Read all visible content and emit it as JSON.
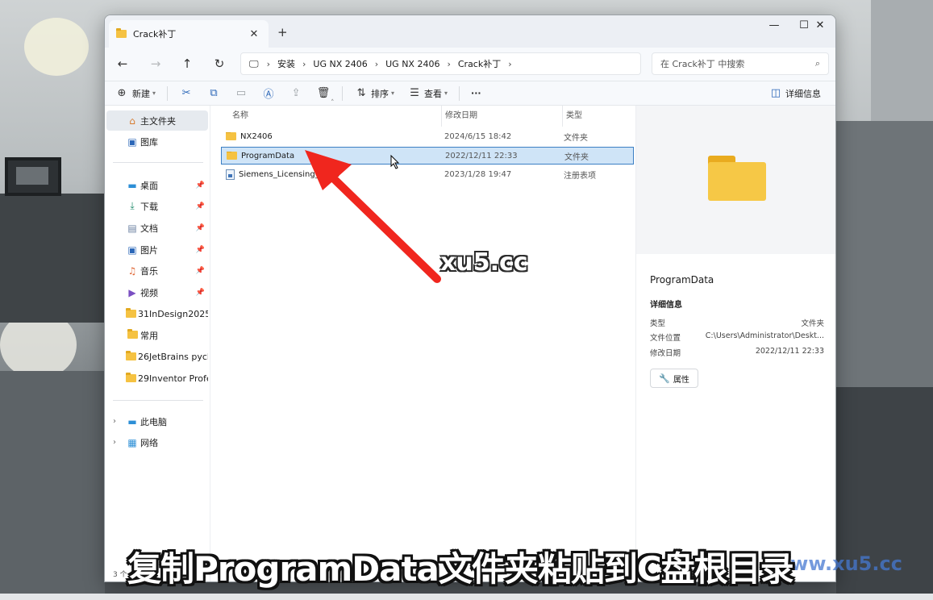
{
  "window": {
    "tab_title": "Crack补丁",
    "tab_close": "✕",
    "new_tab": "+",
    "min": "—",
    "max": "☐",
    "close": "✕"
  },
  "address": {
    "crumbs": [
      "安装",
      "UG NX 2406",
      "UG NX 2406",
      "Crack补丁"
    ],
    "search_placeholder": "在 Crack补丁 中搜索"
  },
  "toolbar": {
    "new_label": "新建",
    "sort_label": "排序",
    "view_label": "查看",
    "more_label": "···",
    "details_label": "详细信息"
  },
  "nav": {
    "home": "主文件夹",
    "gallery": "图库",
    "desktop": "桌面",
    "downloads": "下载",
    "documents": "文档",
    "pictures": "图片",
    "music": "音乐",
    "videos": "视频",
    "folder1": "31InDesign2025",
    "folder2": "常用",
    "folder3": "26JetBrains pycha",
    "folder4": "29Inventor Profes",
    "this_pc": "此电脑",
    "network": "网络"
  },
  "columns": {
    "name": "名称",
    "modified": "修改日期",
    "type": "类型"
  },
  "files": [
    {
      "name": "NX2406",
      "modified": "2024/6/15 18:42",
      "type": "文件夹"
    },
    {
      "name": "ProgramData",
      "modified": "2022/12/11 22:33",
      "type": "文件夹"
    },
    {
      "name": "Siemens_Licensing_SS....",
      "modified": "2023/1/28 19:47",
      "type": "注册表项"
    }
  ],
  "details": {
    "name": "ProgramData",
    "section": "详细信息",
    "type_key": "类型",
    "type_val": "文件夹",
    "location_key": "文件位置",
    "location_val": "C:\\Users\\Administrator\\Deskt...",
    "modified_key": "修改日期",
    "modified_val": "2022/12/11 22:33",
    "properties_btn": "属性"
  },
  "status": {
    "count": "3 个"
  },
  "overlay": {
    "watermark": "xu5.cc",
    "watermark2": "www.xu5.cc",
    "caption": "复制ProgramData文件夹粘贴到C盘根目录"
  },
  "colors": {
    "selection": "#cfe4f7",
    "accent": "#2b67b8",
    "arrow": "#f0261e"
  }
}
